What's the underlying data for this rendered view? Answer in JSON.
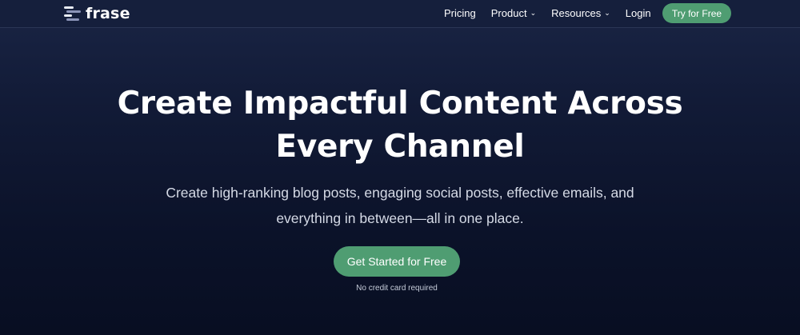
{
  "brand": {
    "name": "frase"
  },
  "nav": {
    "items": [
      {
        "label": "Pricing",
        "has_dropdown": false
      },
      {
        "label": "Product",
        "has_dropdown": true
      },
      {
        "label": "Resources",
        "has_dropdown": true
      },
      {
        "label": "Login",
        "has_dropdown": false
      }
    ],
    "cta_label": "Try for Free"
  },
  "hero": {
    "title_line1": "Create Impactful Content Across",
    "title_line2": "Every Channel",
    "subtitle_line1": "Create high-ranking blog posts, engaging social posts, effective emails, and",
    "subtitle_line2": "everything in between—all in one place.",
    "cta_label": "Get Started for Free",
    "note": "No credit card required"
  },
  "colors": {
    "accent": "#4f9d72",
    "background_top": "#1a2545",
    "background_bottom": "#080e22"
  },
  "icons": {
    "logo": "frase-logo-icon",
    "dropdown": "chevron-down-icon"
  }
}
